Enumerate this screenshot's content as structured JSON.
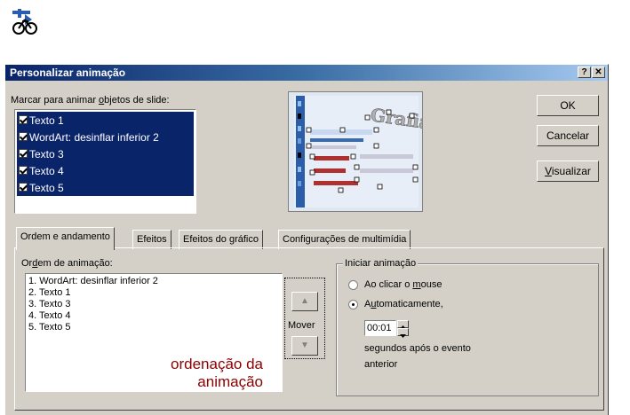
{
  "toolbar": {
    "icon": "custom-animation-icon"
  },
  "dialog": {
    "title": "Personalizar animação",
    "help_button": "?",
    "close_button": "✕",
    "select_label_pre": "Marcar para animar ",
    "select_label_ul": "o",
    "select_label_post": "bjetos de slide:",
    "objects": [
      {
        "label": "Texto 1",
        "checked": true
      },
      {
        "label": "WordArt: desinflar inferior 2",
        "checked": true
      },
      {
        "label": "Texto 3",
        "checked": true
      },
      {
        "label": "Texto 4",
        "checked": true
      },
      {
        "label": "Texto 5",
        "checked": true
      }
    ],
    "preview_text": "Grafia",
    "buttons": {
      "ok": "OK",
      "cancel": "Cancelar",
      "preview_ul": "V",
      "preview_rest": "isualizar"
    },
    "tabs": [
      "Ordem e andamento",
      "Efeitos",
      "Efeitos do gráfico",
      "Configurações de multimídia"
    ],
    "order": {
      "label_pre": "Or",
      "label_ul": "d",
      "label_post": "em de animação:",
      "items": [
        "1. WordArt: desinflar inferior 2",
        "2. Texto 1",
        "3. Texto 3",
        "4. Texto 4",
        "5. Texto 5"
      ],
      "move_label": "Mover",
      "up_icon": "▲",
      "down_icon": "▼"
    },
    "start": {
      "group_label": "Iniciar animação",
      "on_click_pre": "Ao clicar o ",
      "on_click_ul": "m",
      "on_click_post": "ouse",
      "auto_pre": "A",
      "auto_ul": "u",
      "auto_post": "tomaticamente,",
      "auto_selected": true,
      "time_value": "00:01",
      "after_line1": "segundos após o evento",
      "after_line2": "anterior"
    }
  },
  "annotation": {
    "line1": "ordenação da",
    "line2": "animação",
    "color": "#8b0000"
  }
}
